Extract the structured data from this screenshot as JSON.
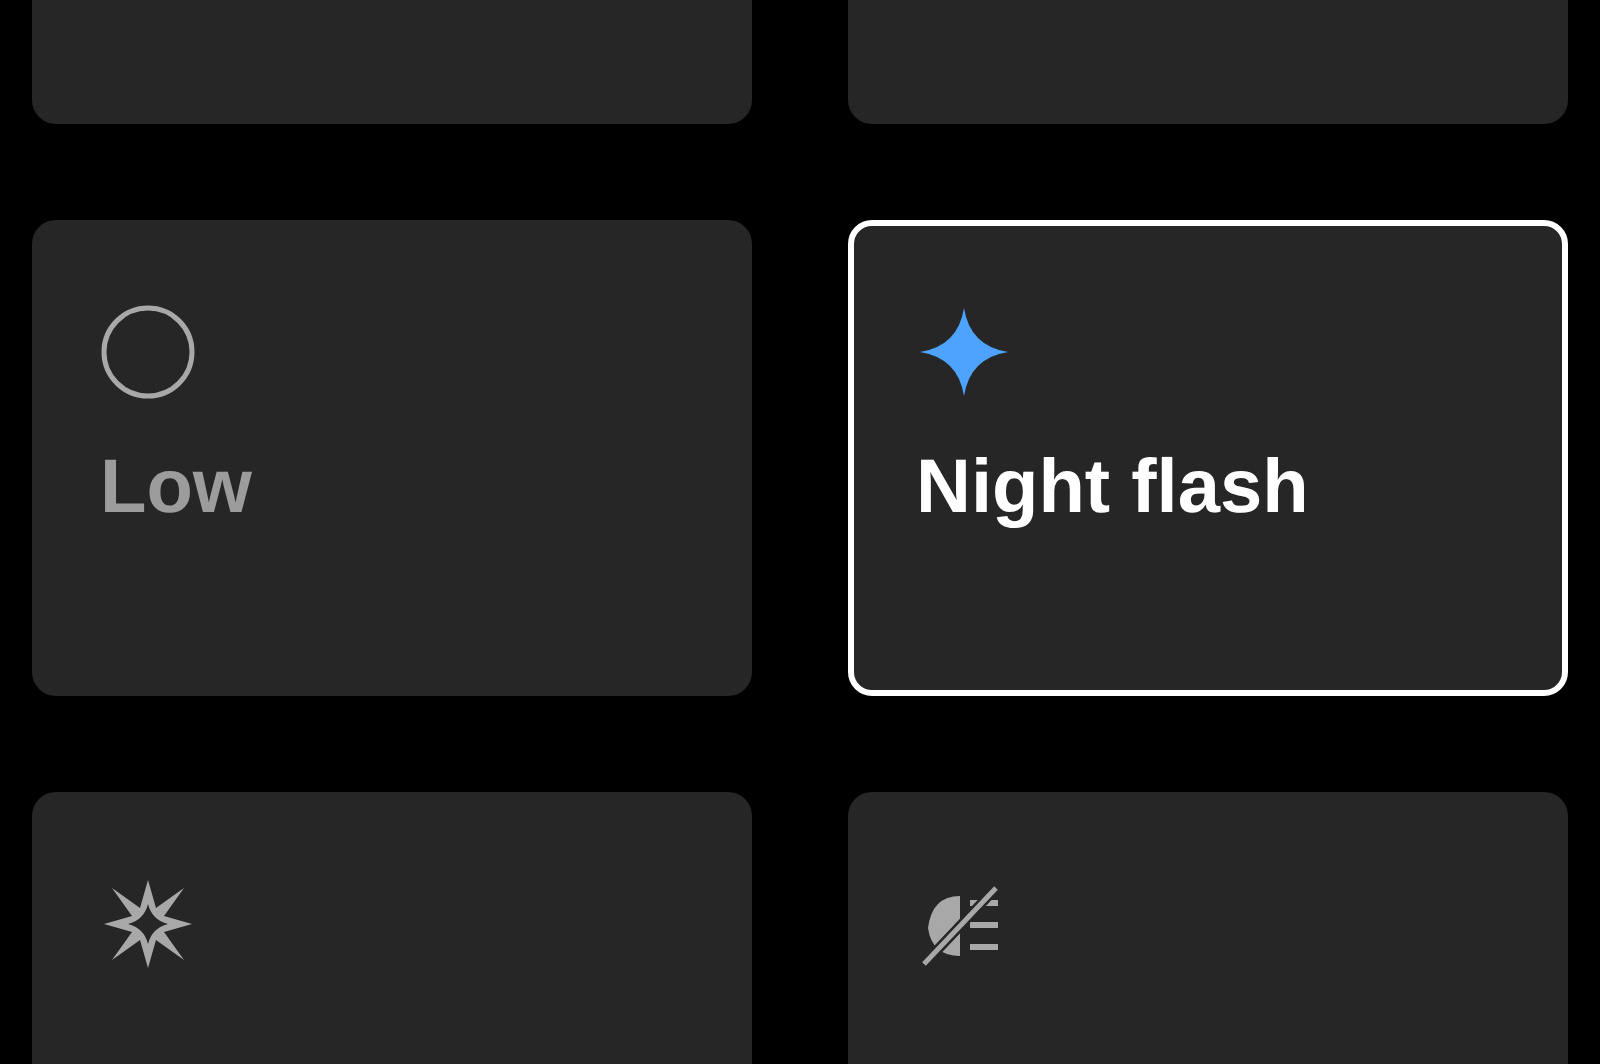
{
  "options": [
    {
      "label": "Low",
      "kind": "circle",
      "selected": false
    },
    {
      "label": "Night flash",
      "kind": "sparkle",
      "selected": true
    },
    {
      "kind": "burst",
      "selected": false
    },
    {
      "kind": "flash-off",
      "selected": false
    }
  ]
}
